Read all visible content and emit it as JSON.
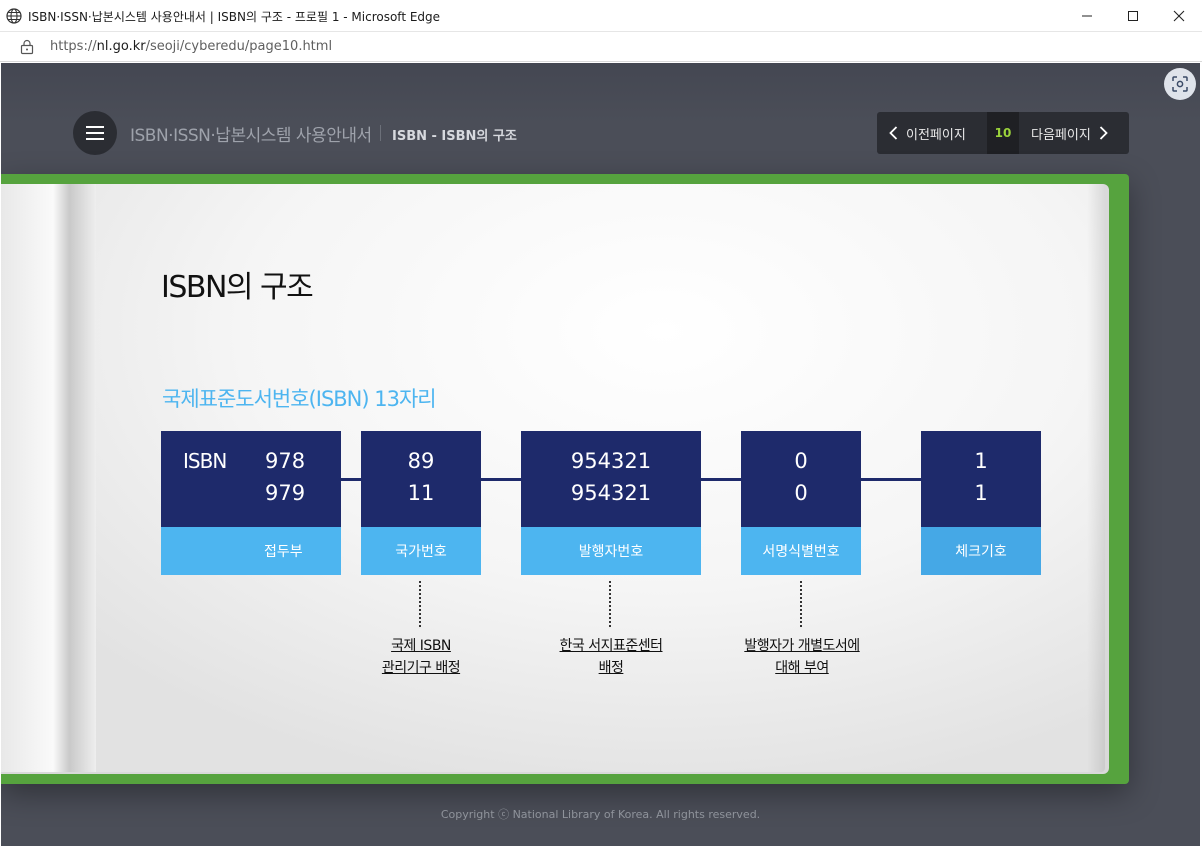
{
  "window": {
    "title": "ISBN·ISSN·납본시스템 사용안내서 | ISBN의 구조 - 프로필 1 - Microsoft Edge"
  },
  "address": {
    "url_prefix": "https://",
    "url_host": "nl.go.kr",
    "url_path": "/seoji/cyberedu/page10.html"
  },
  "header": {
    "site_title": "ISBN·ISSN·납본시스템 사용안내서",
    "section_title": "ISBN - ISBN의 구조"
  },
  "pager": {
    "prev_label": "이전페이지",
    "page_number": "10",
    "next_label": "다음페이지"
  },
  "content": {
    "heading": "ISBN의 구조",
    "subheading": "국제표준도서번호(ISBN) 13자리",
    "blocks": [
      {
        "prefix": "ISBN",
        "line1": "978",
        "line2": "979",
        "label": "접두부"
      },
      {
        "line1": "89",
        "line2": "11",
        "label": "국가번호"
      },
      {
        "line1": "954321",
        "line2": "954321",
        "label": "발행자번호"
      },
      {
        "line1": "0",
        "line2": "0",
        "label": "서명식별번호"
      },
      {
        "line1": "1",
        "line2": "1",
        "label": "체크기호"
      }
    ],
    "notes": [
      {
        "line1": "국제 ISBN",
        "line2": "관리기구 배정"
      },
      {
        "line1": "한국 서지표준센터",
        "line2": "배정"
      },
      {
        "line1": "발행자가 개별도서에",
        "line2": "대해 부여"
      }
    ]
  },
  "footer": {
    "copyright": "Copyright ⓒ National Library of Korea. All rights reserved."
  },
  "colors": {
    "navy": "#1e2a6b",
    "sky": "#4db5f0",
    "cover_green": "#56a33e",
    "page_number_green": "#9bd33b"
  },
  "icons": [
    "globe-icon",
    "minimize-icon",
    "maximize-icon",
    "close-icon",
    "lock-icon",
    "screenshot-icon",
    "hamburger-icon",
    "chevron-left-icon",
    "chevron-right-icon"
  ]
}
